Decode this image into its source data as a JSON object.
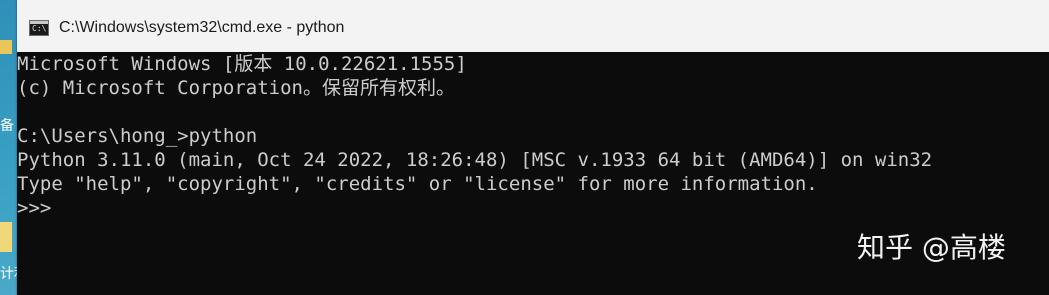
{
  "window": {
    "title": "C:\\Windows\\system32\\cmd.exe - python",
    "icon": "console-icon"
  },
  "console": {
    "lines": [
      "Microsoft Windows [版本 10.0.22621.1555]",
      "(c) Microsoft Corporation。保留所有权利。",
      "",
      "C:\\Users\\hong_>python",
      "Python 3.11.0 (main, Oct 24 2022, 18:26:48) [MSC v.1933 64 bit (AMD64)] on win32",
      "Type \"help\", \"copyright\", \"credits\" or \"license\" for more information.",
      ">>>"
    ]
  },
  "desktop": {
    "left_snippets": [
      "备",
      "计利"
    ]
  },
  "watermark": "知乎 @高楼",
  "colors": {
    "console_bg": "#0c0c0c",
    "console_text": "#cccccc",
    "titlebar_bg": "#f3f3f3",
    "desktop_bg": "#3aa0c4"
  }
}
